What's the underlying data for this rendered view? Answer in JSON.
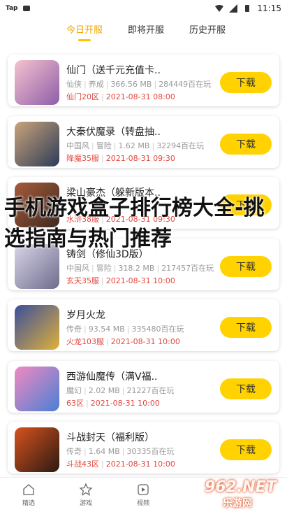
{
  "status": {
    "app_label": "Tap",
    "time": "11:15",
    "colors": {
      "accent": "#ffd200",
      "red": "#e2483e",
      "gray": "#999999"
    }
  },
  "tabs": [
    {
      "label": "今日开服",
      "active": true
    },
    {
      "label": "即将开服",
      "active": false
    },
    {
      "label": "历史开服",
      "active": false
    }
  ],
  "games": [
    {
      "name": "仙门（送千元充值卡..",
      "meta": [
        "仙侠",
        "养成",
        "366.56 MB",
        "284449百在玩"
      ],
      "server": "仙门20区",
      "datetime": "2021-08-31 08:00",
      "button": "下载",
      "thumb_colors": [
        "#f5c2cf",
        "#8e5ea8"
      ]
    },
    {
      "name": "大秦伏魔录（转盘抽..",
      "meta": [
        "中国风",
        "冒险",
        "1.62 MB",
        "32294百在玩"
      ],
      "server": "降魔35服",
      "datetime": "2021-08-31 09:30",
      "button": "下载",
      "thumb_colors": [
        "#c9a47a",
        "#2d3b58"
      ]
    },
    {
      "name": "梁山豪杰（躲新版本..",
      "meta": [
        "",
        "",
        "",
        ""
      ],
      "server": "水浒38服",
      "datetime": "2021-08-31 09:30",
      "button": "下载",
      "thumb_colors": [
        "#a65b3a",
        "#3d2a22"
      ]
    },
    {
      "name": "铸剑（修仙3D版）",
      "meta": [
        "中国风",
        "冒险",
        "318.2 MB",
        "217457百在玩"
      ],
      "server": "玄天35服",
      "datetime": "2021-08-31 10:00",
      "button": "下载",
      "thumb_colors": [
        "#d9d4e8",
        "#6d6c8c"
      ]
    },
    {
      "name": "岁月火龙",
      "meta": [
        "传奇",
        "",
        "93.54 MB",
        "335480百在玩"
      ],
      "server": "火龙103服",
      "datetime": "2021-08-31 10:00",
      "button": "下载",
      "thumb_colors": [
        "#3b4f9c",
        "#e0b03a"
      ]
    },
    {
      "name": "西游仙魔传（满V福..",
      "meta": [
        "魔幻",
        "",
        "2.02 MB",
        "21227百在玩"
      ],
      "server": "63区",
      "datetime": "2021-08-31 10:00",
      "button": "下载",
      "thumb_colors": [
        "#f08ac0",
        "#4a7fd6"
      ]
    },
    {
      "name": "斗战封天（福利版）",
      "meta": [
        "传奇",
        "",
        "1.64 MB",
        "30335百在玩"
      ],
      "server": "斗战43区",
      "datetime": "2021-08-31 10:00",
      "button": "下载",
      "thumb_colors": [
        "#d7521e",
        "#2b1a12"
      ]
    }
  ],
  "overlay_title": "手机游戏盒子排行榜大全-挑选指南与热门推荐",
  "bottom_nav": [
    {
      "label": "精选",
      "icon": "home-icon"
    },
    {
      "label": "游戏",
      "icon": "star-icon"
    },
    {
      "label": "视频",
      "icon": "video-icon"
    }
  ],
  "watermark": {
    "text": "962.NET",
    "sub": "乐游网"
  }
}
